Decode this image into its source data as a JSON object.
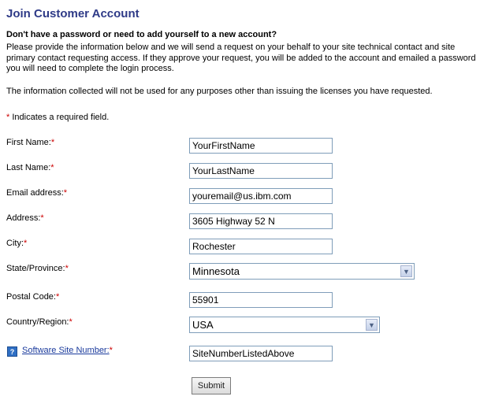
{
  "title": "Join Customer Account",
  "subhead": "Don't have a password or need to add yourself to a new account?",
  "intro_line1": "Please provide the information below and we will send a request on your behalf to your site technical contact and site",
  "intro_line2": "primary contact requesting access. If they approve your request, you will be added to the account and emailed a password",
  "intro_line3": "you will need to complete the login process.",
  "info_note": "The information collected will not be used for any purposes other than issuing the licenses you have requested.",
  "required_star": "*",
  "required_note": " Indicates a required field.",
  "fields": {
    "first_name": {
      "label": "First Name:",
      "value": "YourFirstName"
    },
    "last_name": {
      "label": "Last Name:",
      "value": "YourLastName"
    },
    "email": {
      "label": "Email address:",
      "value": "youremail@us.ibm.com"
    },
    "address": {
      "label": "Address:",
      "value": "3605 Highway 52 N"
    },
    "city": {
      "label": "City:",
      "value": "Rochester"
    },
    "state": {
      "label": "State/Province:",
      "value": "Minnesota"
    },
    "postal": {
      "label": "Postal Code:",
      "value": "55901"
    },
    "country": {
      "label": "Country/Region:",
      "value": "USA"
    },
    "site_number": {
      "label": "Software Site Number:",
      "value": "SiteNumberListedAbove"
    }
  },
  "help_icon_glyph": "?",
  "submit_label": "Submit",
  "colors": {
    "title": "#2e3a87",
    "required": "#cc0000",
    "link": "#1a3a9c"
  }
}
